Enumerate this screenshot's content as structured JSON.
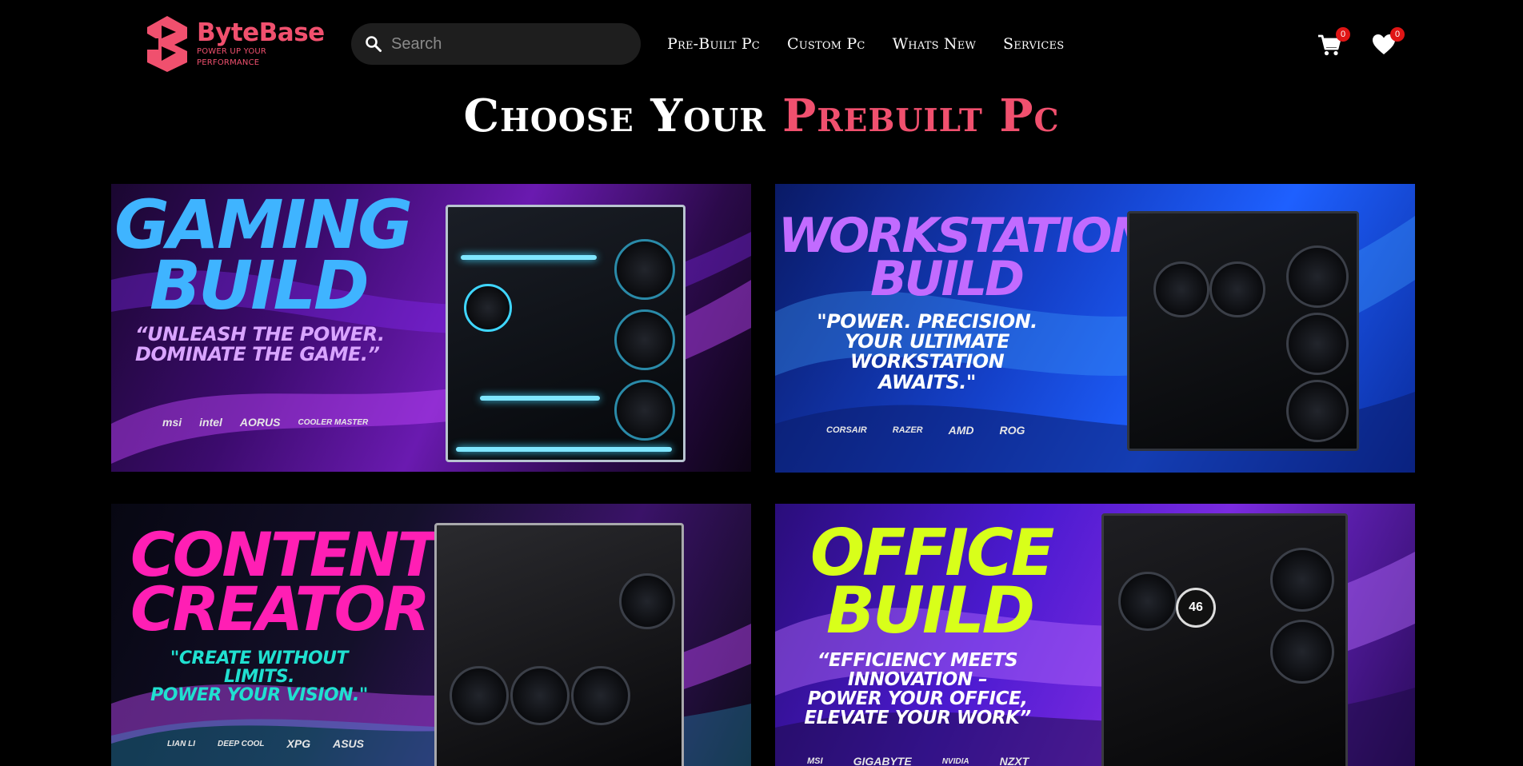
{
  "header": {
    "logo": {
      "name": "ByteBase",
      "tagline": "POWER UP YOUR PERFORMANCE"
    },
    "search": {
      "placeholder": "Search",
      "value": ""
    },
    "nav": [
      {
        "label": "Pre-Built Pc"
      },
      {
        "label": "Custom Pc"
      },
      {
        "label": "Whats New"
      },
      {
        "label": "Services"
      }
    ],
    "cart": {
      "count": "0"
    },
    "wishlist": {
      "count": "0"
    }
  },
  "page": {
    "heading_main": "Choose Your",
    "heading_accent": "Prebuilt Pc"
  },
  "cards": {
    "gaming": {
      "title_line1": "GAMING",
      "title_line2": "BUILD",
      "quote_line1": "“UNLEASH THE POWER.",
      "quote_line2": "DOMINATE THE GAME.”",
      "brands": [
        "msi",
        "intel",
        "AORUS",
        "COOLER MASTER"
      ]
    },
    "workstation": {
      "title_line1": "WORKSTATION",
      "title_line2": "BUILD",
      "quote_line1": "\"POWER. PRECISION.",
      "quote_line2": "YOUR ULTIMATE",
      "quote_line3": "WORKSTATION",
      "quote_line4": "AWAITS.\"",
      "brands": [
        "CORSAIR",
        "RAZER",
        "AMD",
        "ROG"
      ]
    },
    "creator": {
      "title_line1": "CONTENT",
      "title_line2": "CREATOR",
      "quote_line1": "\"CREATE WITHOUT LIMITS.",
      "quote_line2": "POWER YOUR VISION.\"",
      "brands": [
        "LIAN LI",
        "DEEP COOL",
        "XPG",
        "ASUS"
      ]
    },
    "office": {
      "title_line1": "OFFICE",
      "title_line2": "BUILD",
      "quote_line1": "“EFFICIENCY MEETS",
      "quote_line2": "INNOVATION –",
      "quote_line3": "POWER YOUR OFFICE,",
      "quote_line4": "ELEVATE YOUR WORK”",
      "brands": [
        "MSI",
        "GIGABYTE",
        "NVIDIA",
        "NZXT"
      ],
      "screen_value": "46"
    }
  },
  "colors": {
    "accent": "#f0506e",
    "badge": "#e01515",
    "gaming_title": "#3fb4ff",
    "workstation_title": "#c26bff",
    "creator_title": "#ff1fb4",
    "creator_quote": "#20e0d0",
    "office_title": "#d8ff1a"
  }
}
